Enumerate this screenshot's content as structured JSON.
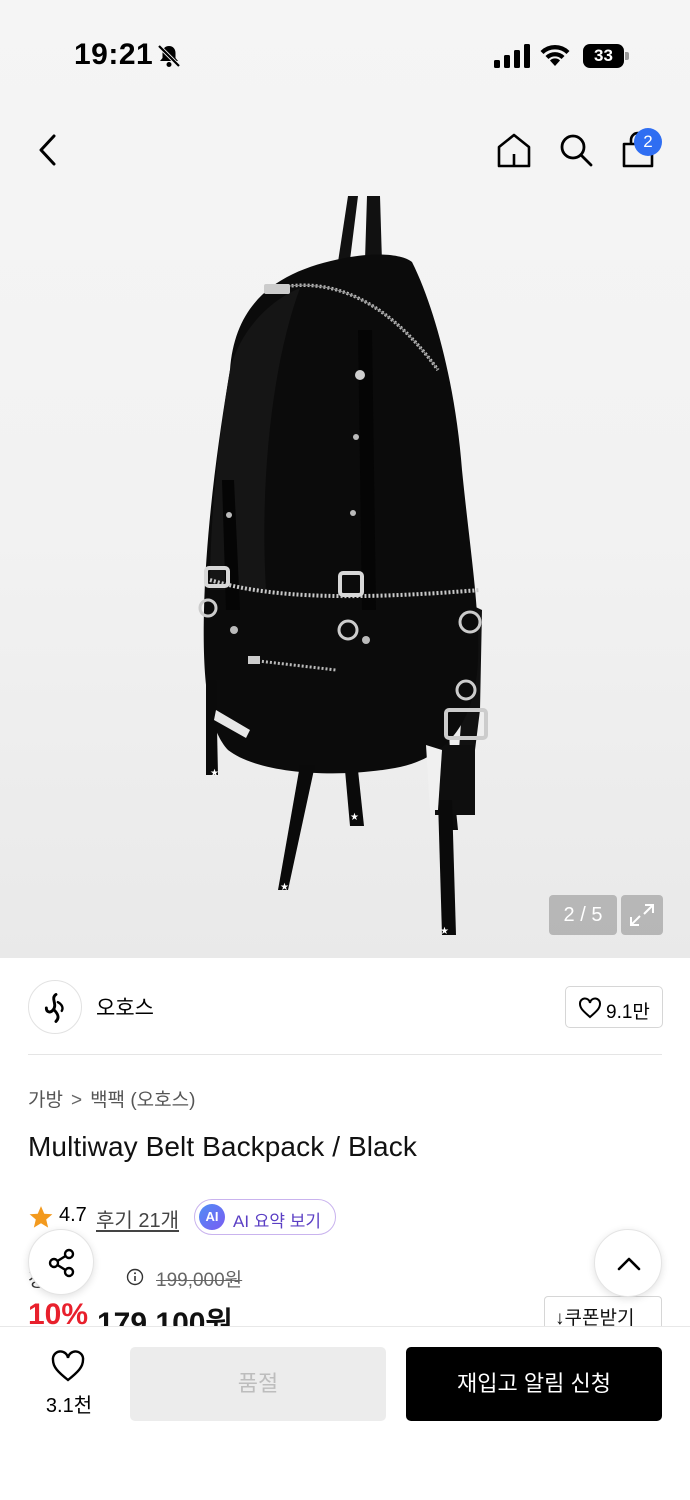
{
  "status_bar": {
    "time": "19:21",
    "battery": "33"
  },
  "header": {
    "cart_count": "2"
  },
  "gallery": {
    "counter": "2 / 5"
  },
  "brand": {
    "name": "오호스",
    "like_count": "9.1만"
  },
  "breadcrumb": {
    "category": "가방",
    "separator": ">",
    "subcategory": "백팩 (오호스)"
  },
  "product": {
    "title": "Multiway Belt Backpack / Black"
  },
  "rating": {
    "value": "4.7",
    "reviews": "후기 21개",
    "ai_badge": "AI",
    "ai_label": "AI 요약 보기"
  },
  "price": {
    "label": "정상가",
    "original": "199,000원",
    "discount": "10%",
    "sale": "179,100원",
    "coupon": "↓쿠폰받기"
  },
  "bottom_bar": {
    "wish_count": "3.1천",
    "soldout_label": "품절",
    "restock_label": "재입고 알림 신청"
  },
  "colors": {
    "accent_red": "#e8202c",
    "badge_blue": "#2f6ef2",
    "ai_purple": "#5b3fc4"
  }
}
